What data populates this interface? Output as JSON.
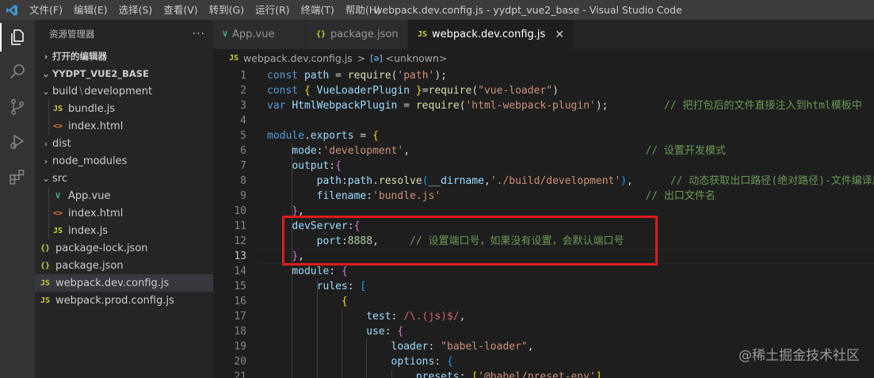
{
  "titlebar": {
    "menu": [
      "文件(F)",
      "编辑(E)",
      "选择(S)",
      "查看(V)",
      "转到(G)",
      "运行(R)",
      "终端(T)",
      "帮助(H)"
    ],
    "title": "webpack.dev.config.js - yydpt_vue2_base - Visual Studio Code"
  },
  "activity": [
    "files-icon",
    "search-icon",
    "source-control-icon",
    "run-debug-icon",
    "extensions-icon"
  ],
  "sidebar": {
    "header": "资源管理器",
    "more": "···",
    "open_editors": "打开的编辑器",
    "project": "YYDPT_VUE2_BASE",
    "tree": [
      {
        "label": "build",
        "sub": "development",
        "type": "folder-open",
        "depth": 1
      },
      {
        "label": "bundle.js",
        "type": "js",
        "depth": 2
      },
      {
        "label": "index.html",
        "type": "html",
        "depth": 2
      },
      {
        "label": "dist",
        "type": "folder",
        "depth": 1
      },
      {
        "label": "node_modules",
        "type": "folder",
        "depth": 1
      },
      {
        "label": "src",
        "type": "folder-open",
        "depth": 1
      },
      {
        "label": "App.vue",
        "type": "vue",
        "depth": 2
      },
      {
        "label": "index.html",
        "type": "html",
        "depth": 2
      },
      {
        "label": "index.js",
        "type": "js",
        "depth": 2
      },
      {
        "label": "package-lock.json",
        "type": "json",
        "depth": 1
      },
      {
        "label": "package.json",
        "type": "json",
        "depth": 1
      },
      {
        "label": "webpack.dev.config.js",
        "type": "js",
        "depth": 1,
        "selected": true
      },
      {
        "label": "webpack.prod.config.js",
        "type": "js",
        "depth": 1
      }
    ]
  },
  "tabs": [
    {
      "label": "App.vue",
      "type": "vue"
    },
    {
      "label": "package.json",
      "type": "json"
    },
    {
      "label": "webpack.dev.config.js",
      "type": "js",
      "active": true
    }
  ],
  "tab_close": "✕",
  "breadcrumb": {
    "file": "webpack.dev.config.js",
    "symbol": "<unknown>",
    "sep": ">",
    "symbol_icon": "[ə]"
  },
  "icon_text": {
    "js": "JS",
    "json": "{}",
    "html": "<>",
    "vue": "V"
  },
  "editor": {
    "current_line": 13,
    "lines": [
      {
        "n": "1",
        "tokens": [
          [
            "kw",
            "const "
          ],
          [
            "var",
            "path"
          ],
          [
            "pun",
            " = "
          ],
          [
            "fn",
            "require"
          ],
          [
            "pun",
            "("
          ],
          [
            "str",
            "'path'"
          ],
          [
            "pun",
            ");"
          ]
        ]
      },
      {
        "n": "2",
        "tokens": [
          [
            "kw",
            "const "
          ],
          [
            "br2",
            "{ "
          ],
          [
            "var",
            "VueLoaderPlugin "
          ],
          [
            "br2",
            "}"
          ],
          [
            "pun",
            "="
          ],
          [
            "fn",
            "require"
          ],
          [
            "pun",
            "("
          ],
          [
            "str",
            "\"vue-loader\""
          ],
          [
            "pun",
            ")"
          ]
        ]
      },
      {
        "n": "3",
        "tokens": [
          [
            "kw",
            "var "
          ],
          [
            "var",
            "HtmlWebpackPlugin"
          ],
          [
            "pun",
            " = "
          ],
          [
            "fn",
            "require"
          ],
          [
            "pun",
            "("
          ],
          [
            "str",
            "'html-webpack-plugin'"
          ],
          [
            "pun",
            ");"
          ],
          [
            "pun",
            "         "
          ],
          [
            "com",
            "// 把打包后的文件直接注入到html模板中"
          ]
        ]
      },
      {
        "n": "4",
        "tokens": []
      },
      {
        "n": "5",
        "tokens": [
          [
            "kw",
            "module"
          ],
          [
            "pun",
            "."
          ],
          [
            "var",
            "exports"
          ],
          [
            "pun",
            " = "
          ],
          [
            "br2",
            "{"
          ]
        ]
      },
      {
        "n": "6",
        "tokens": [
          [
            "pun",
            "    "
          ],
          [
            "var",
            "mode"
          ],
          [
            "pun",
            ":"
          ],
          [
            "str",
            "'development'"
          ],
          [
            "pun",
            ",                                      "
          ],
          [
            "com",
            "// 设置开发模式"
          ]
        ]
      },
      {
        "n": "7",
        "tokens": [
          [
            "pun",
            "    "
          ],
          [
            "var",
            "output"
          ],
          [
            "pun",
            ":"
          ],
          [
            "br",
            "{"
          ]
        ]
      },
      {
        "n": "8",
        "tokens": [
          [
            "pun",
            "        "
          ],
          [
            "var",
            "path"
          ],
          [
            "pun",
            ":"
          ],
          [
            "var",
            "path"
          ],
          [
            "pun",
            "."
          ],
          [
            "fn",
            "resolve"
          ],
          [
            "br3",
            "("
          ],
          [
            "var",
            "__dirname"
          ],
          [
            "pun",
            ","
          ],
          [
            "str",
            "'./build/development'"
          ],
          [
            "br3",
            ")"
          ],
          [
            "pun",
            ",      "
          ],
          [
            "com",
            "// 动态获取出口路径(绝对路径)-文件编译后"
          ]
        ]
      },
      {
        "n": "9",
        "tokens": [
          [
            "pun",
            "        "
          ],
          [
            "var",
            "filename"
          ],
          [
            "pun",
            ":"
          ],
          [
            "str",
            "'bundle.js'"
          ],
          [
            "pun",
            "                                 "
          ],
          [
            "com",
            "// 出口文件名"
          ]
        ]
      },
      {
        "n": "10",
        "tokens": [
          [
            "pun",
            "    "
          ],
          [
            "br",
            "}"
          ],
          [
            "pun",
            ","
          ]
        ]
      },
      {
        "n": "11",
        "tokens": [
          [
            "pun",
            "    "
          ],
          [
            "var",
            "devServer"
          ],
          [
            "pun",
            ":"
          ],
          [
            "br",
            "{"
          ]
        ]
      },
      {
        "n": "12",
        "tokens": [
          [
            "pun",
            "        "
          ],
          [
            "var",
            "port"
          ],
          [
            "pun",
            ":"
          ],
          [
            "num",
            "8888"
          ],
          [
            "pun",
            ",     "
          ],
          [
            "com",
            "// 设置端口号，如果没有设置，会默认端口号"
          ]
        ]
      },
      {
        "n": "13",
        "tokens": [
          [
            "pun",
            "    "
          ],
          [
            "br",
            "}"
          ],
          [
            "pun",
            ","
          ]
        ]
      },
      {
        "n": "14",
        "tokens": [
          [
            "pun",
            "    "
          ],
          [
            "var",
            "module"
          ],
          [
            "pun",
            ": "
          ],
          [
            "br",
            "{"
          ]
        ]
      },
      {
        "n": "15",
        "tokens": [
          [
            "pun",
            "        "
          ],
          [
            "var",
            "rules"
          ],
          [
            "pun",
            ": "
          ],
          [
            "br3",
            "["
          ]
        ]
      },
      {
        "n": "16",
        "tokens": [
          [
            "pun",
            "            "
          ],
          [
            "br2",
            "{"
          ]
        ]
      },
      {
        "n": "17",
        "tokens": [
          [
            "pun",
            "                "
          ],
          [
            "var",
            "test"
          ],
          [
            "pun",
            ": "
          ],
          [
            "rx",
            "/\\.(js)$/"
          ],
          [
            "pun",
            ","
          ]
        ]
      },
      {
        "n": "18",
        "tokens": [
          [
            "pun",
            "                "
          ],
          [
            "var",
            "use"
          ],
          [
            "pun",
            ": "
          ],
          [
            "br",
            "{"
          ]
        ]
      },
      {
        "n": "19",
        "tokens": [
          [
            "pun",
            "                    "
          ],
          [
            "var",
            "loader"
          ],
          [
            "pun",
            ": "
          ],
          [
            "str",
            "\"babel-loader\""
          ],
          [
            "pun",
            ","
          ]
        ]
      },
      {
        "n": "20",
        "tokens": [
          [
            "pun",
            "                    "
          ],
          [
            "var",
            "options"
          ],
          [
            "pun",
            ": "
          ],
          [
            "br3",
            "{"
          ]
        ]
      },
      {
        "n": "21",
        "tokens": [
          [
            "pun",
            "                        "
          ],
          [
            "var",
            "presets"
          ],
          [
            "pun",
            ": "
          ],
          [
            "br2",
            "["
          ],
          [
            "str",
            "'@babel/preset-env'"
          ],
          [
            "br2",
            "]"
          ],
          [
            "pun",
            ","
          ]
        ]
      }
    ]
  },
  "watermark": "@稀土掘金技术社区"
}
